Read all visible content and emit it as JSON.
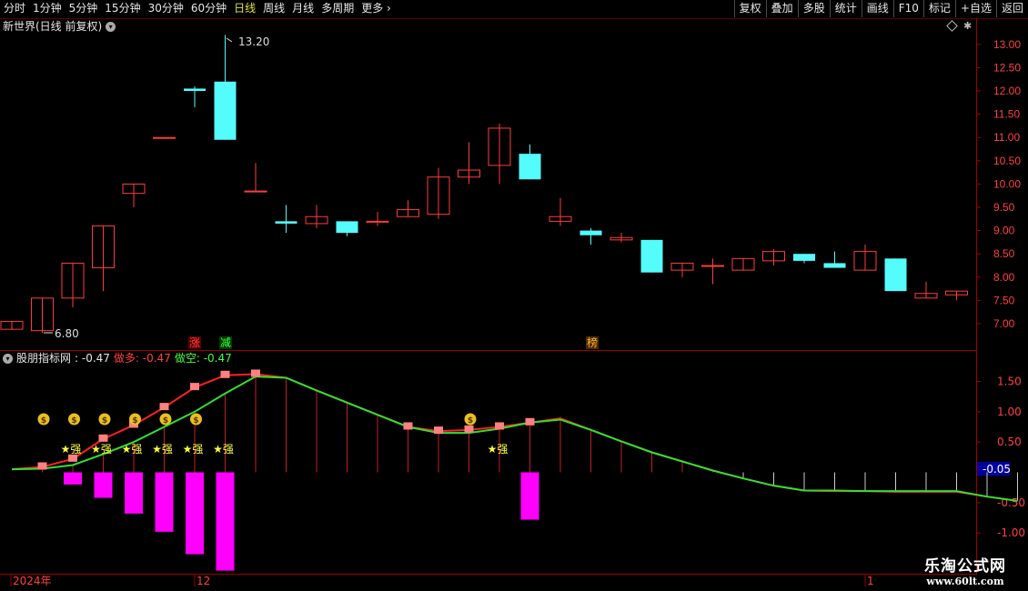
{
  "toolbar": {
    "periods": [
      "分时",
      "1分钟",
      "5分钟",
      "15分钟",
      "30分钟",
      "60分钟",
      "日线",
      "周线",
      "月线",
      "多周期",
      "更多"
    ],
    "active_period": "日线",
    "more_arrow": "chevron-right-icon",
    "right_buttons": [
      "复权",
      "叠加",
      "多股",
      "统计",
      "画线",
      "F10",
      "标记",
      "+自选",
      "返回"
    ]
  },
  "main_chart": {
    "title": "新世界(日线 前复权)",
    "high_label": "13.20",
    "low_label": "6.80",
    "markers": [
      {
        "text": "涨",
        "color": "#ff4040",
        "bg": "#5a0000"
      },
      {
        "text": "减",
        "color": "#40ff40",
        "bg": "#003a00"
      },
      {
        "text": "榜",
        "color": "#ffb040",
        "bg": "#4a2a00"
      }
    ]
  },
  "indicator": {
    "name": "股朋指标网",
    "value": ": -0.47",
    "bull_label": "做多: -0.47",
    "bear_label": "做空: -0.47",
    "current_tag": "-0.05",
    "badge_text": "★强",
    "money_icon": "money-bag-icon"
  },
  "x_axis": {
    "labels": [
      "2024年",
      "12",
      "1"
    ]
  },
  "watermark": {
    "line1": "乐淘公式网",
    "line2": "www.60lt.com"
  },
  "colors": {
    "up": "#ff3c3c",
    "down": "#54fcfc",
    "bull_line": "#ff2020",
    "bear_line": "#30e030",
    "bar_neg": "#ff00ff",
    "marker_sq": "#ff8080",
    "axis": "#a00000"
  },
  "chart_data": [
    {
      "type": "candlestick",
      "y_axis": {
        "ticks": [
          7.0,
          7.5,
          8.0,
          8.5,
          9.0,
          9.5,
          10.0,
          10.5,
          11.0,
          11.5,
          12.0,
          12.5,
          13.0
        ],
        "range": [
          6.5,
          13.5
        ]
      },
      "candles": [
        {
          "o": 6.88,
          "h": 7.05,
          "l": 6.88,
          "c": 7.05
        },
        {
          "o": 6.85,
          "h": 7.55,
          "l": 6.8,
          "c": 7.55
        },
        {
          "o": 7.55,
          "h": 8.3,
          "l": 7.35,
          "c": 8.3
        },
        {
          "o": 8.2,
          "h": 9.1,
          "l": 7.7,
          "c": 9.1
        },
        {
          "o": 9.8,
          "h": 10.0,
          "l": 9.5,
          "c": 10.0
        },
        {
          "o": 11.0,
          "h": 11.0,
          "l": 11.0,
          "c": 11.0
        },
        {
          "o": 12.05,
          "h": 12.1,
          "l": 11.65,
          "c": 12.0
        },
        {
          "o": 12.2,
          "h": 13.2,
          "l": 10.95,
          "c": 10.95
        },
        {
          "o": 9.85,
          "h": 10.45,
          "l": 9.85,
          "c": 9.85
        },
        {
          "o": 9.2,
          "h": 9.55,
          "l": 8.95,
          "c": 9.15
        },
        {
          "o": 9.15,
          "h": 9.55,
          "l": 9.05,
          "c": 9.3
        },
        {
          "o": 9.2,
          "h": 9.2,
          "l": 8.88,
          "c": 8.95
        },
        {
          "o": 9.2,
          "h": 9.4,
          "l": 9.1,
          "c": 9.2
        },
        {
          "o": 9.3,
          "h": 9.65,
          "l": 9.3,
          "c": 9.45
        },
        {
          "o": 9.35,
          "h": 10.35,
          "l": 9.25,
          "c": 10.15
        },
        {
          "o": 10.15,
          "h": 10.9,
          "l": 10.0,
          "c": 10.3
        },
        {
          "o": 10.4,
          "h": 11.3,
          "l": 10.0,
          "c": 11.2
        },
        {
          "o": 10.65,
          "h": 10.85,
          "l": 10.1,
          "c": 10.1
        },
        {
          "o": 9.2,
          "h": 9.7,
          "l": 9.1,
          "c": 9.3
        },
        {
          "o": 9.0,
          "h": 9.05,
          "l": 8.7,
          "c": 8.9
        },
        {
          "o": 8.8,
          "h": 8.95,
          "l": 8.75,
          "c": 8.85
        },
        {
          "o": 8.8,
          "h": 8.8,
          "l": 8.1,
          "c": 8.1
        },
        {
          "o": 8.15,
          "h": 8.3,
          "l": 8.0,
          "c": 8.3
        },
        {
          "o": 8.25,
          "h": 8.4,
          "l": 7.85,
          "c": 8.25
        },
        {
          "o": 8.15,
          "h": 8.4,
          "l": 8.15,
          "c": 8.4
        },
        {
          "o": 8.35,
          "h": 8.6,
          "l": 8.25,
          "c": 8.55
        },
        {
          "o": 8.5,
          "h": 8.5,
          "l": 8.3,
          "c": 8.35
        },
        {
          "o": 8.3,
          "h": 8.55,
          "l": 8.2,
          "c": 8.2
        },
        {
          "o": 8.15,
          "h": 8.7,
          "l": 8.15,
          "c": 8.55
        },
        {
          "o": 8.4,
          "h": 8.4,
          "l": 7.7,
          "c": 7.7
        },
        {
          "o": 7.55,
          "h": 7.9,
          "l": 7.55,
          "c": 7.65
        },
        {
          "o": 7.62,
          "h": 7.7,
          "l": 7.5,
          "c": 7.7
        }
      ]
    },
    {
      "type": "line",
      "y_axis": {
        "ticks": [
          -1.0,
          -0.5,
          0.5,
          1.0,
          1.5
        ],
        "range": [
          -1.2,
          1.9
        ]
      },
      "series": [
        {
          "name": "做多",
          "values": [
            0.05,
            0.09,
            0.22,
            0.55,
            0.78,
            1.07,
            1.4,
            1.6,
            1.62,
            1.56,
            1.35,
            1.15,
            0.95,
            0.75,
            0.68,
            0.7,
            0.75,
            0.82,
            0.89,
            0.7,
            0.51,
            0.33,
            0.18,
            0.03,
            -0.1,
            -0.22,
            -0.3,
            -0.31,
            -0.31,
            -0.32,
            -0.32,
            -0.32,
            -0.4,
            -0.47
          ]
        },
        {
          "name": "做空",
          "values": [
            0.05,
            0.06,
            0.12,
            0.3,
            0.5,
            0.75,
            1.0,
            1.3,
            1.58,
            1.56,
            1.35,
            1.15,
            0.95,
            0.75,
            0.65,
            0.65,
            0.72,
            0.82,
            0.87,
            0.7,
            0.51,
            0.33,
            0.18,
            0.03,
            -0.1,
            -0.22,
            -0.3,
            -0.3,
            -0.31,
            -0.31,
            -0.31,
            -0.31,
            -0.4,
            -0.47
          ]
        }
      ],
      "bars": [
        0,
        0,
        -0.2,
        -0.42,
        -0.68,
        -0.98,
        -1.35,
        -1.62,
        0,
        0,
        0,
        0,
        0,
        0,
        0,
        0,
        0,
        -0.78,
        0,
        0,
        0,
        0,
        0,
        0,
        0,
        0,
        0,
        0,
        0,
        0,
        0,
        0,
        0,
        0
      ],
      "signals_strong": [
        2,
        3,
        4,
        5,
        6,
        7,
        16
      ],
      "signals_money": [
        2,
        3,
        4,
        5,
        6,
        7,
        16
      ],
      "markers_sq": [
        1,
        2,
        3,
        4,
        5,
        6,
        7,
        8,
        13,
        14,
        15,
        16,
        17
      ]
    }
  ]
}
